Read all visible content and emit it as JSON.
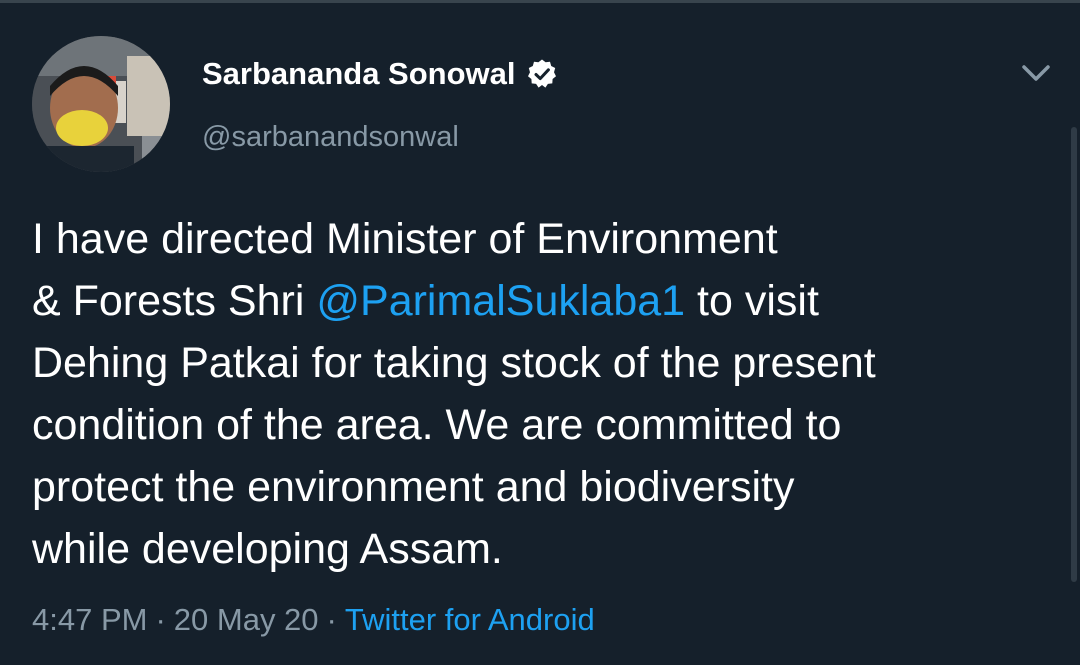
{
  "author": {
    "display_name": "Sarbananda Sonowal",
    "handle": "@sarbanandsonwal",
    "verified": true,
    "avatar_icon": "profile-photo"
  },
  "tweet": {
    "line1": "I have directed Minister of Environment",
    "line2_pre": "& Forests Shri ",
    "line2_mention": "@ParimalSuklaba1",
    "line2_post": " to visit",
    "line3": "Dehing Patkai for taking stock of the present",
    "line4": "condition of the area. We are committed to",
    "line5": "protect the environment and biodiversity",
    "line6": "while developing Assam."
  },
  "meta": {
    "time": "4:47 PM",
    "date": "20 May 20",
    "separator": "·",
    "source": "Twitter for Android"
  },
  "icons": {
    "verified": "verified-badge-icon",
    "menu": "chevron-down-icon"
  },
  "colors": {
    "background": "#15202b",
    "link": "#1da1f2",
    "muted": "#8899a6",
    "text": "#ffffff"
  }
}
